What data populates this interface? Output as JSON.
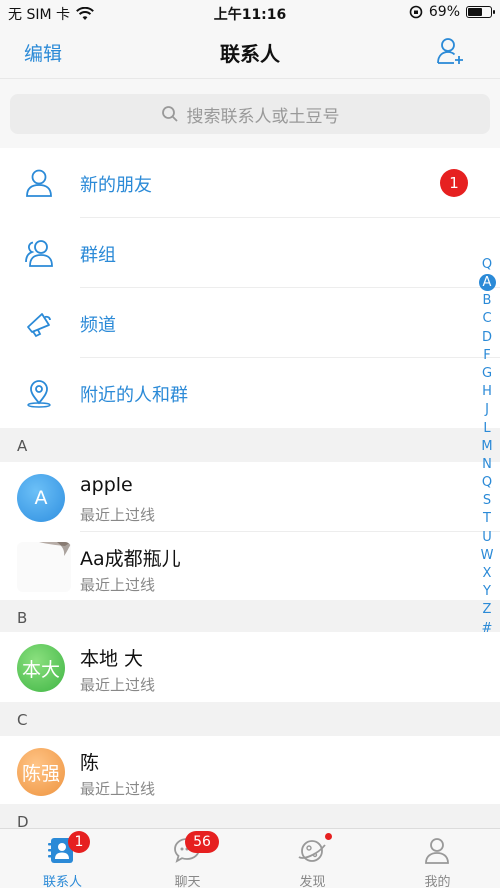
{
  "status_bar": {
    "carrier": "无 SIM 卡",
    "time": "上午11:16",
    "battery_percent": "69%",
    "battery_level": 0.69
  },
  "nav": {
    "edit_label": "编辑",
    "title": "联系人",
    "add_icon": "add-person-icon"
  },
  "search": {
    "placeholder": "搜索联系人或土豆号",
    "icon": "search-icon"
  },
  "menu": [
    {
      "label": "新的朋友",
      "icon": "person-icon",
      "badge": "1"
    },
    {
      "label": "群组",
      "icon": "group-icon"
    },
    {
      "label": "频道",
      "icon": "megaphone-icon"
    },
    {
      "label": "附近的人和群",
      "icon": "location-pin-icon"
    }
  ],
  "sections": [
    {
      "letter": "A",
      "contacts": [
        {
          "name": "apple",
          "status": "最近上过线",
          "avatar_text": "A",
          "avatar_color": "#3a9be8"
        },
        {
          "name": "Aa成都瓶儿",
          "status": "最近上过线",
          "avatar_text": ""
        }
      ]
    },
    {
      "letter": "B",
      "contacts": [
        {
          "name": "本地 大",
          "status": "最近上过线",
          "avatar_text": "本大",
          "avatar_color": "#5cc85a"
        }
      ]
    },
    {
      "letter": "C",
      "contacts": [
        {
          "name": "陈",
          "status": "最近上过线",
          "avatar_text": "陈强",
          "avatar_color": "#f2a85a"
        }
      ]
    },
    {
      "letter": "D",
      "contacts": []
    }
  ],
  "index_bar": [
    "Q",
    "A",
    "B",
    "C",
    "D",
    "F",
    "G",
    "H",
    "J",
    "L",
    "M",
    "N",
    "Q",
    "S",
    "T",
    "U",
    "W",
    "X",
    "Y",
    "Z",
    "#"
  ],
  "index_active": "A",
  "tabs": [
    {
      "label": "联系人",
      "icon": "contacts-icon",
      "badge": "1",
      "active": true
    },
    {
      "label": "聊天",
      "icon": "chat-bubble-icon",
      "badge": "56"
    },
    {
      "label": "发现",
      "icon": "planet-icon",
      "dot": true
    },
    {
      "label": "我的",
      "icon": "profile-icon"
    }
  ],
  "colors": {
    "accent": "#2b8ad7",
    "badge": "#e62020",
    "background": "#f7f7f7"
  }
}
